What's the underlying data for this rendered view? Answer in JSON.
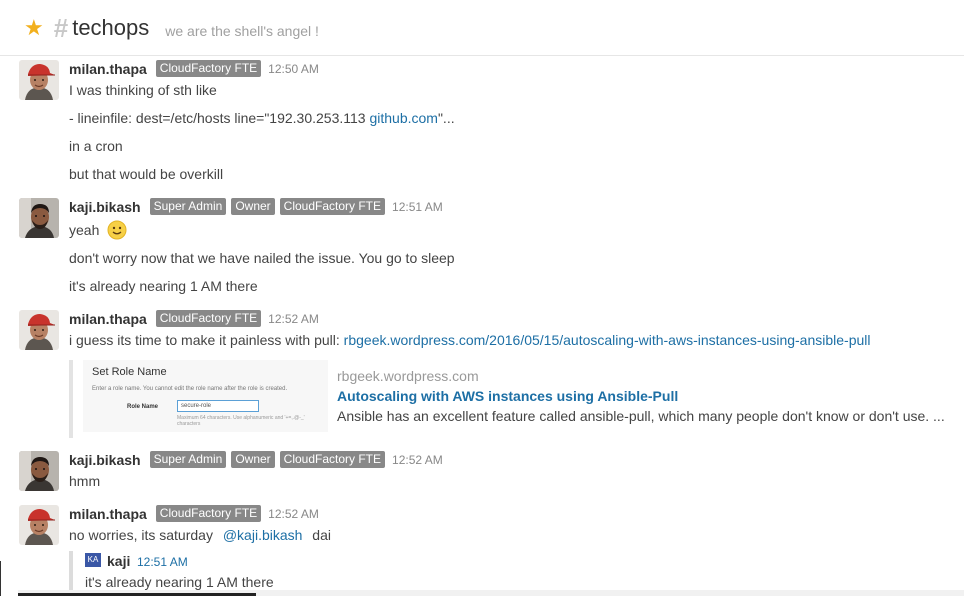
{
  "header": {
    "channel": "techops",
    "topic": "we are the shell's angel !",
    "star_color": "#f2b01e"
  },
  "messages": [
    {
      "user": "milan.thapa",
      "roles": [
        "CloudFactory FTE"
      ],
      "time": "12:50 AM",
      "lines": [
        "I was thinking of sth like",
        "- lineinfile: dest=/etc/hosts line=\"192.30.253.113 ",
        "in a cron",
        "but that would be overkill"
      ],
      "link_text": "github.com",
      "link_suffix": "\"..."
    },
    {
      "user": "kaji.bikash",
      "roles": [
        "Super Admin",
        "Owner",
        "CloudFactory FTE"
      ],
      "time": "12:51 AM",
      "lines": [
        "yeah",
        "don't worry now that we have nailed the issue. You go to sleep",
        "it's already nearing 1 AM there"
      ],
      "emoji": "slightly-smiling-face"
    },
    {
      "user": "milan.thapa",
      "roles": [
        "CloudFactory FTE"
      ],
      "time": "12:52 AM",
      "text_prefix": "i guess its time to make it painless with pull: ",
      "link_text": "rbgeek.wordpress.com/2016/05/15/autoscaling-with-aws-instances-using-ansible-pull",
      "attachment": {
        "site": "rbgeek.wordpress.com",
        "title": "Autoscaling with AWS instances using Ansible-Pull",
        "description": "Ansible has an excellent feature called ansible-pull, which many people don't know or don't use. ...",
        "thumb": {
          "title": "Set Role Name",
          "subtitle": "Enter a role name. You cannot edit the role name after the role is created.",
          "field_label": "Role Name",
          "field_value": "secure-role",
          "hint": "Maximum 64 characters. Use alphanumeric and '+=,.@-_' characters"
        }
      }
    },
    {
      "user": "kaji.bikash",
      "roles": [
        "Super Admin",
        "Owner",
        "CloudFactory FTE"
      ],
      "time": "12:52 AM",
      "lines": [
        "hmm"
      ]
    },
    {
      "user": "milan.thapa",
      "roles": [
        "CloudFactory FTE"
      ],
      "time": "12:52 AM",
      "text_prefix": "no worries, its saturday ",
      "mention": "@kaji.bikash",
      "text_suffix": " dai",
      "quote": {
        "avatar_initials": "KA",
        "user": "kaji",
        "time": "12:51 AM",
        "text": "it's already nearing 1 AM there"
      }
    }
  ]
}
